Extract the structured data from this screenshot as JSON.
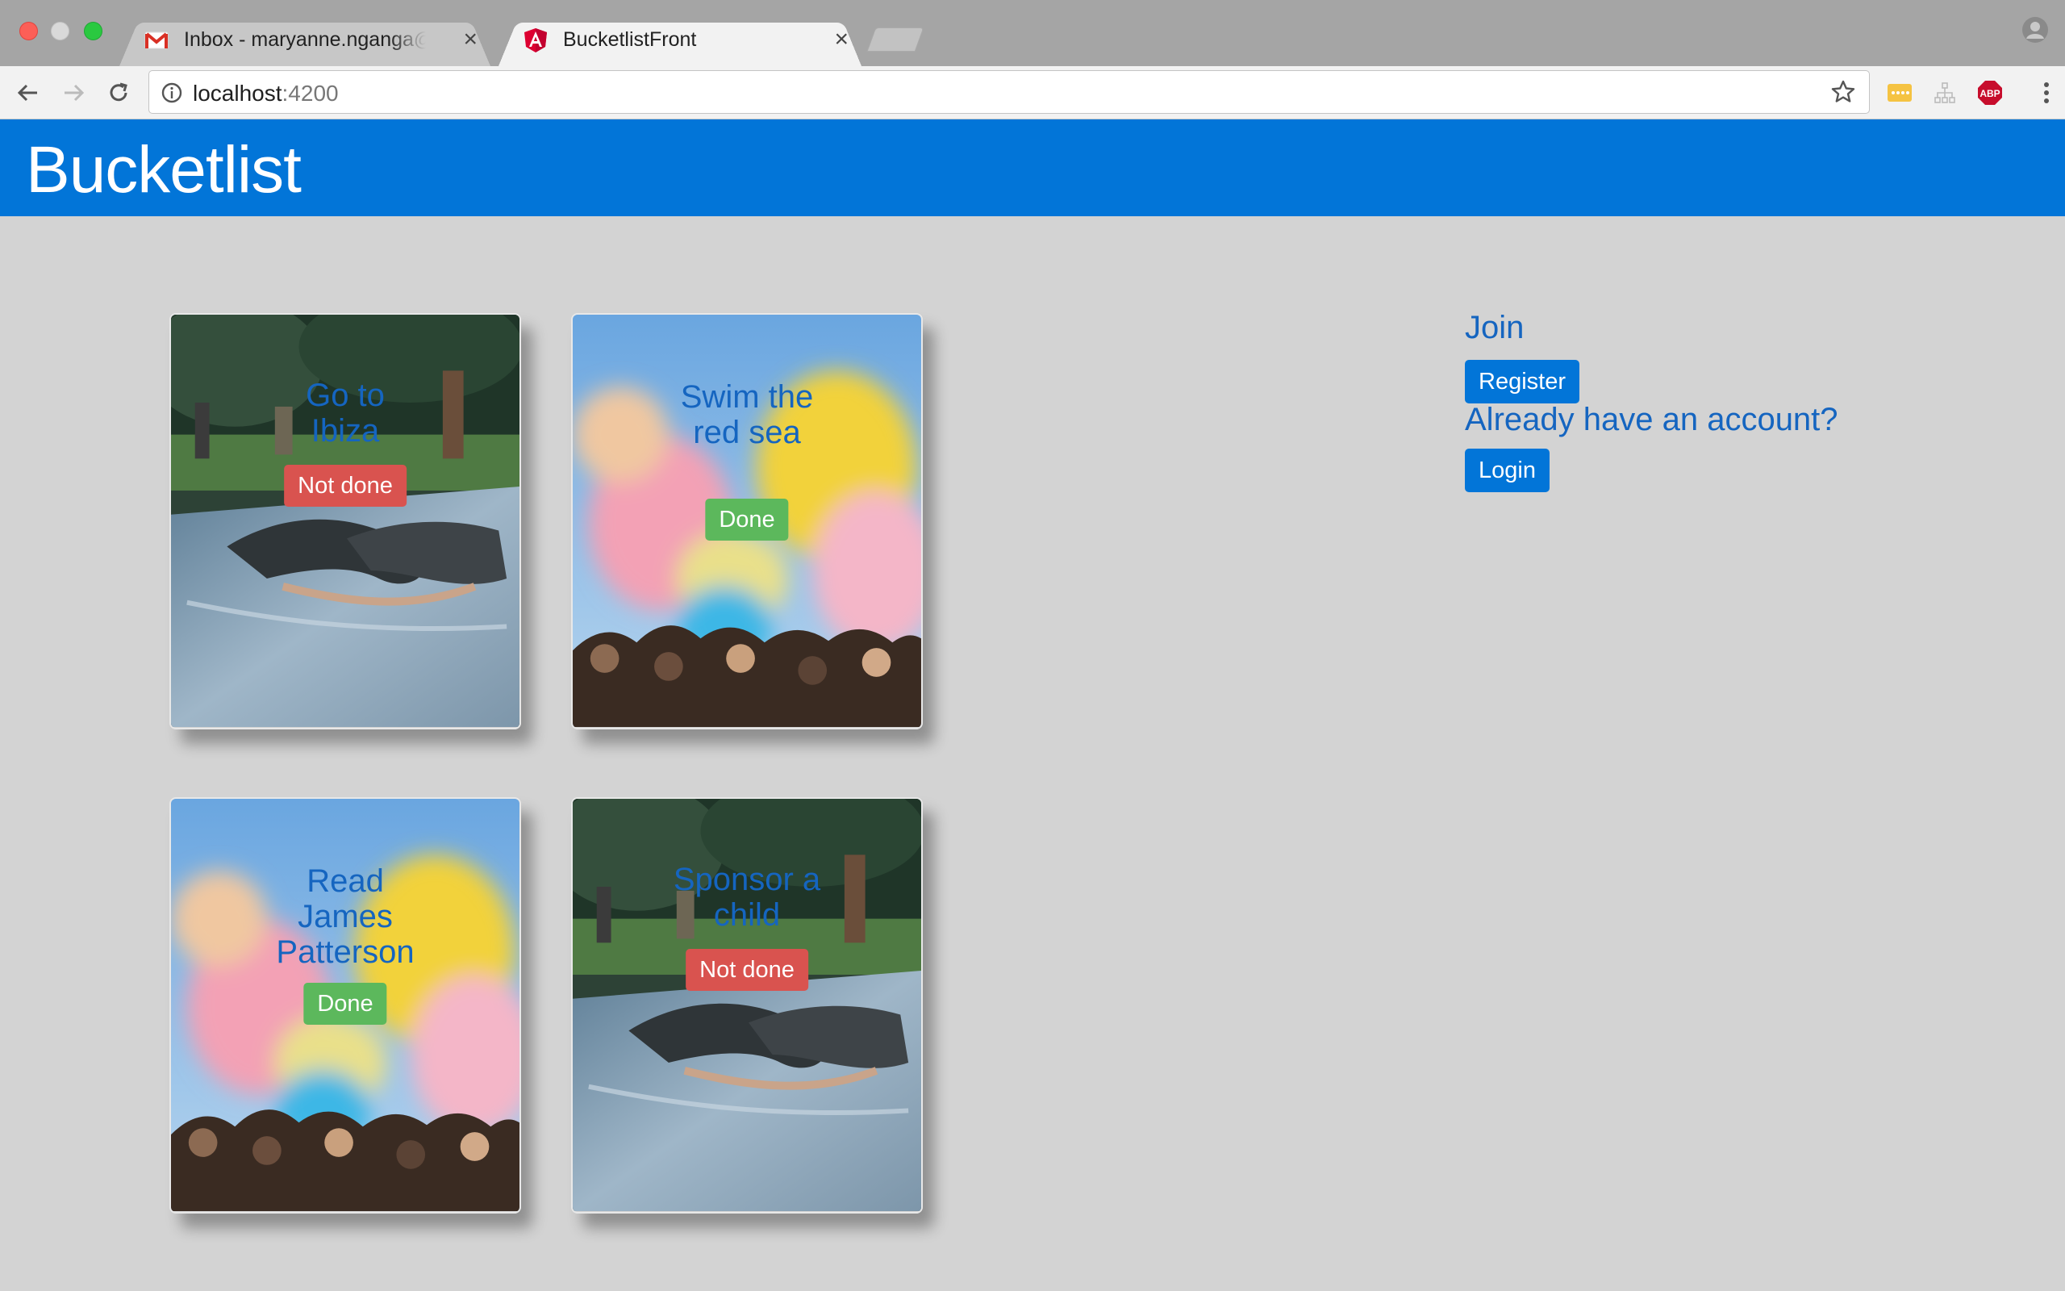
{
  "browser": {
    "tabs": [
      {
        "title": "Inbox - maryanne.nganga@andela.com",
        "icon": "gmail-icon",
        "active": false
      },
      {
        "title": "BucketlistFront",
        "icon": "angular-icon",
        "active": true
      }
    ],
    "url_host": "localhost",
    "url_port": ":4200"
  },
  "app": {
    "title": "Bucketlist"
  },
  "items": [
    {
      "title": "Go to Ibiza",
      "status": "Not done",
      "image": "waterslide-photo"
    },
    {
      "title": "Swim the red sea",
      "status": "Done",
      "image": "color-festival-photo"
    },
    {
      "title": "Read James Patterson",
      "status": "Done",
      "image": "color-festival-photo"
    },
    {
      "title": "Sponsor a child",
      "status": "Not done",
      "image": "waterslide-photo"
    }
  ],
  "auth": {
    "join_heading": "Join",
    "register_label": "Register",
    "account_heading": "Already have an account?",
    "login_label": "Login"
  },
  "colors": {
    "brand": "#0275d8",
    "done": "#5cb85c",
    "not_done": "#d9534f",
    "background": "#d3d3d3"
  }
}
